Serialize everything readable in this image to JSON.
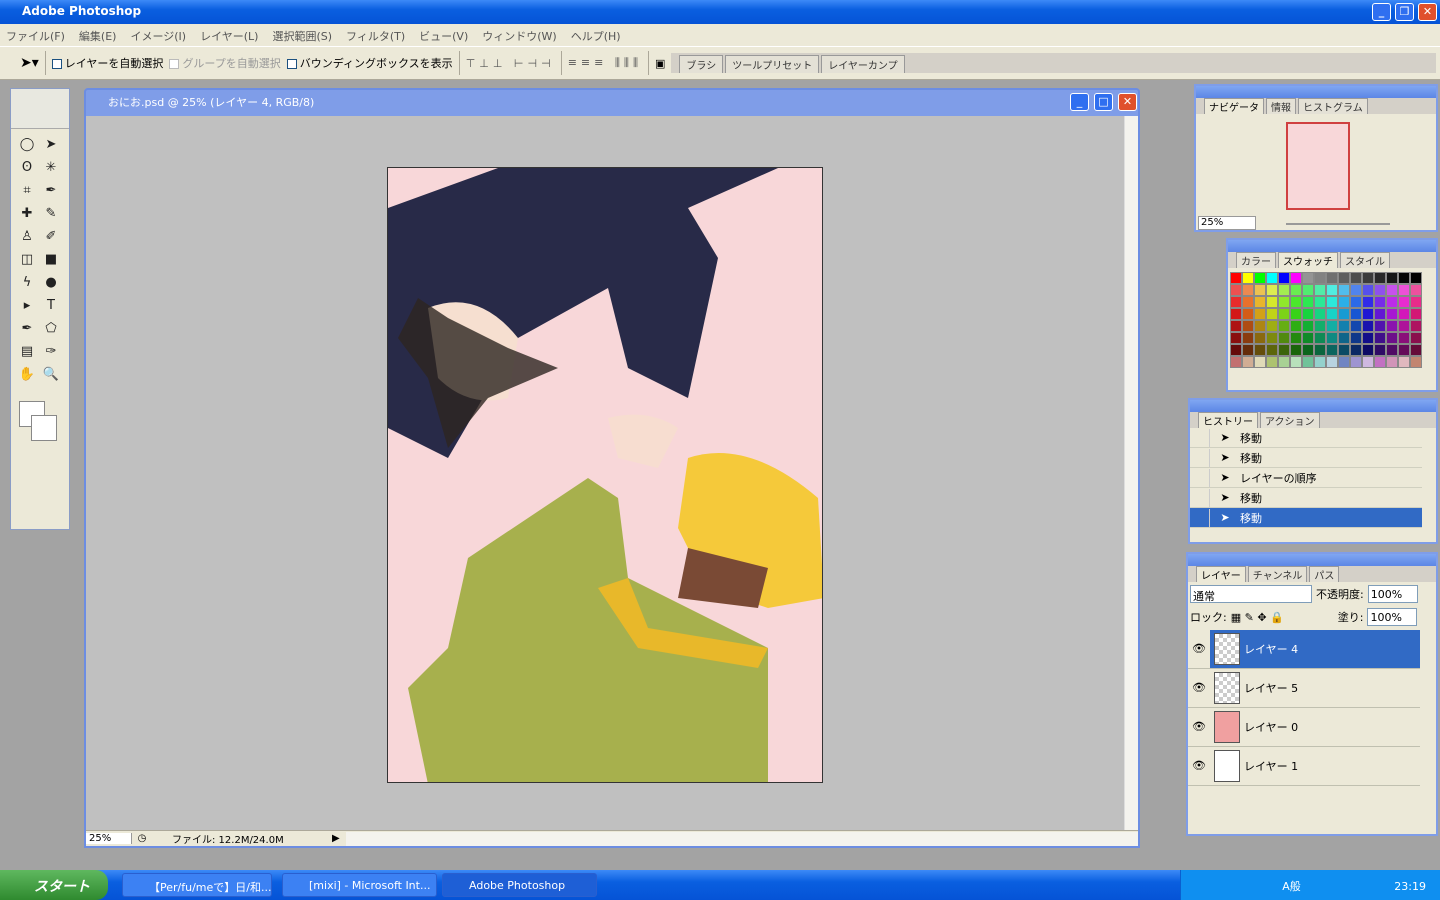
{
  "app": {
    "title": "Adobe Photoshop"
  },
  "menu": [
    "ファイル(F)",
    "編集(E)",
    "イメージ(I)",
    "レイヤー(L)",
    "選択範囲(S)",
    "フィルタ(T)",
    "ビュー(V)",
    "ウィンドウ(W)",
    "ヘルプ(H)"
  ],
  "options": {
    "auto_select_layer": "レイヤーを自動選択",
    "auto_select_group": "グループを自動選択",
    "show_bounding_box": "バウンディングボックスを表示"
  },
  "palette_well": [
    "ブラシ",
    "ツールプリセット",
    "レイヤーカンプ"
  ],
  "document": {
    "title": "おにお.psd @ 25% (レイヤー 4, RGB/8)",
    "zoom": "25%",
    "file_info": "ファイル: 12.2M/24.0M"
  },
  "navigator": {
    "tabs": [
      "ナビゲータ",
      "情報",
      "ヒストグラム"
    ],
    "zoom": "25%"
  },
  "swatches": {
    "tabs": [
      "カラー",
      "スウォッチ",
      "スタイル"
    ]
  },
  "history": {
    "tabs": [
      "ヒストリー",
      "アクション"
    ],
    "items": [
      "移動",
      "移動",
      "レイヤーの順序",
      "移動",
      "移動"
    ],
    "selected": 4
  },
  "layers": {
    "tabs": [
      "レイヤー",
      "チャンネル",
      "パス"
    ],
    "blend_mode": "通常",
    "opacity_label": "不透明度:",
    "opacity": "100%",
    "lock_label": "ロック:",
    "fill_label": "塗り:",
    "fill": "100%",
    "items": [
      {
        "name": "レイヤー 4",
        "selected": true
      },
      {
        "name": "レイヤー 5"
      },
      {
        "name": "レイヤー 0",
        "color": "#f0a0a0"
      },
      {
        "name": "レイヤー 1",
        "color": "#ffffff"
      }
    ]
  },
  "taskbar": {
    "start": "スタート",
    "buttons": [
      "【Per/fu/meで】日/和...",
      "[mixi] - Microsoft Int...",
      "Adobe Photoshop"
    ],
    "ime": "A般",
    "clock": "23:19"
  },
  "colors": {
    "accent": "#316ac5",
    "canvas_bg": "#f8d7d9"
  }
}
